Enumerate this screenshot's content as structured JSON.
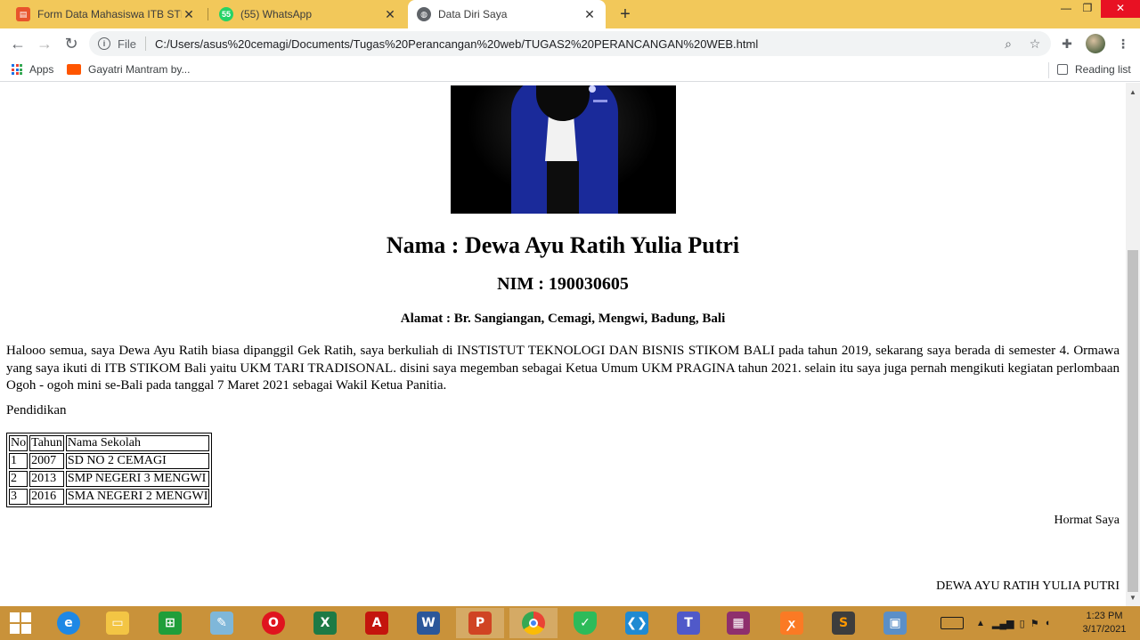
{
  "browser": {
    "tabs": [
      {
        "title": "Form Data Mahasiswa ITB STIKOM",
        "icon": "form-icon",
        "color": "#e8542c"
      },
      {
        "title": "(55) WhatsApp",
        "icon": "whatsapp-icon",
        "color": "#25d366",
        "badge": "55"
      },
      {
        "title": "Data Diri Saya",
        "icon": "globe-icon",
        "active": true
      }
    ],
    "url_scheme": "File",
    "url": "C:/Users/asus%20cemagi/Documents/Tugas%20Perancangan%20web/TUGAS2%20PERANCANGAN%20WEB.html",
    "bookmarks": [
      {
        "label": "Apps",
        "icon": "apps-grid-icon"
      },
      {
        "label": "Gayatri Mantram by...",
        "icon": "soundcloud-icon"
      }
    ],
    "reading_list": "Reading list"
  },
  "page": {
    "name_heading": "Nama : Dewa Ayu Ratih Yulia Putri",
    "nim_heading": "NIM : 190030605",
    "address_heading": "Alamat : Br. Sangiangan, Cemagi, Mengwi, Badung, Bali",
    "bio": "Halooo semua, saya Dewa Ayu Ratih biasa dipanggil Gek Ratih, saya berkuliah di INSTISTUT TEKNOLOGI DAN BISNIS STIKOM BALI pada tahun 2019, sekarang saya berada di semester 4. Ormawa yang saya ikuti di ITB STIKOM Bali yaitu UKM TARI TRADISONAL. disini saya megemban sebagai Ketua Umum UKM PRAGINA tahun 2021. selain itu saya juga pernah mengikuti kegiatan perlombaan Ogoh - ogoh mini se-Bali pada tanggal 7 Maret 2021 sebagai Wakil Ketua Panitia.",
    "education_label": "Pendidikan",
    "education_table": {
      "headers": [
        "No",
        "Tahun",
        "Nama Sekolah"
      ],
      "rows": [
        [
          "1",
          "2007",
          "SD NO 2 CEMAGI"
        ],
        [
          "2",
          "2013",
          "SMP NEGERI 3 MENGWI"
        ],
        [
          "3",
          "2016",
          "SMA NEGERI 2 MENGWI"
        ]
      ]
    },
    "closing": "Hormat Saya",
    "signature_name": "DEWA AYU RATIH YULIA PUTRI"
  },
  "taskbar": {
    "apps": [
      "start-icon",
      "internet-explorer-icon",
      "file-explorer-icon",
      "store-icon",
      "notepad-icon",
      "opera-icon",
      "excel-icon",
      "acrobat-icon",
      "word-icon",
      "powerpoint-icon",
      "chrome-icon",
      "security-icon",
      "vscode-icon",
      "teams-icon",
      "winrar-icon",
      "xampp-icon",
      "sublime-icon",
      "photos-icon"
    ],
    "time": "1:23 PM",
    "date": "3/17/2021"
  },
  "colors": {
    "tabstrip": "#f2c85a",
    "taskbar": "#c9923a",
    "jacket": "#1a2a9a"
  }
}
